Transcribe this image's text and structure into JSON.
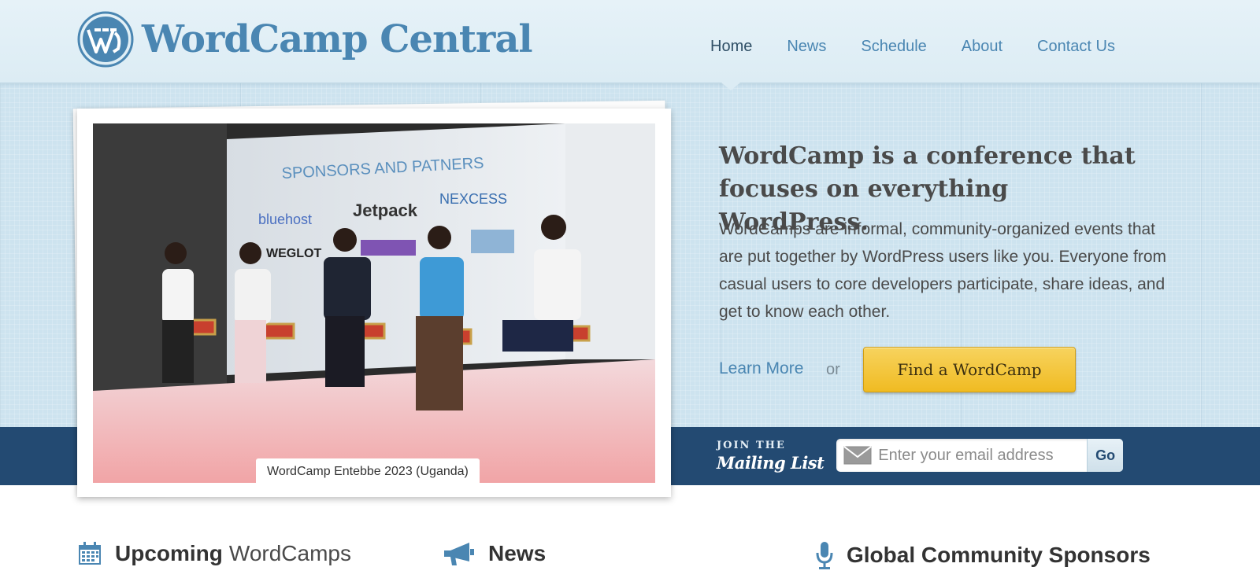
{
  "site": {
    "logo_text": "WordCamp Central"
  },
  "nav": {
    "items": [
      {
        "label": "Home",
        "active": true
      },
      {
        "label": "News",
        "active": false
      },
      {
        "label": "Schedule",
        "active": false
      },
      {
        "label": "About",
        "active": false
      },
      {
        "label": "Contact Us",
        "active": false
      }
    ]
  },
  "hero": {
    "photo_caption": "WordCamp Entebbe 2023 (Uganda)",
    "heading": "WordCamp is a conference that focuses on everything WordPress.",
    "body": "WordCamps are informal, community-organized events that are put together by WordPress users like you. Everyone from casual users to core developers participate, share ideas, and get to know each other.",
    "learn_more_label": "Learn More",
    "or_text": "or",
    "find_button_label": "Find a WordCamp"
  },
  "mailing": {
    "join_small": "JOIN THE",
    "join_big": "Mailing List",
    "email_placeholder": "Enter your email address",
    "go_label": "Go"
  },
  "sections": {
    "upcoming": {
      "bold": "Upcoming",
      "light": "WordCamps",
      "icon": "calendar-icon"
    },
    "news": {
      "bold": "News",
      "icon": "megaphone-icon"
    },
    "sponsors": {
      "bold": "Global Community Sponsors",
      "icon": "microphone-icon"
    }
  },
  "colors": {
    "brand_blue": "#4a86b2",
    "band_navy": "#234a72",
    "button_yellow": "#f0bb22",
    "hero_bg": "#cde3ef"
  }
}
